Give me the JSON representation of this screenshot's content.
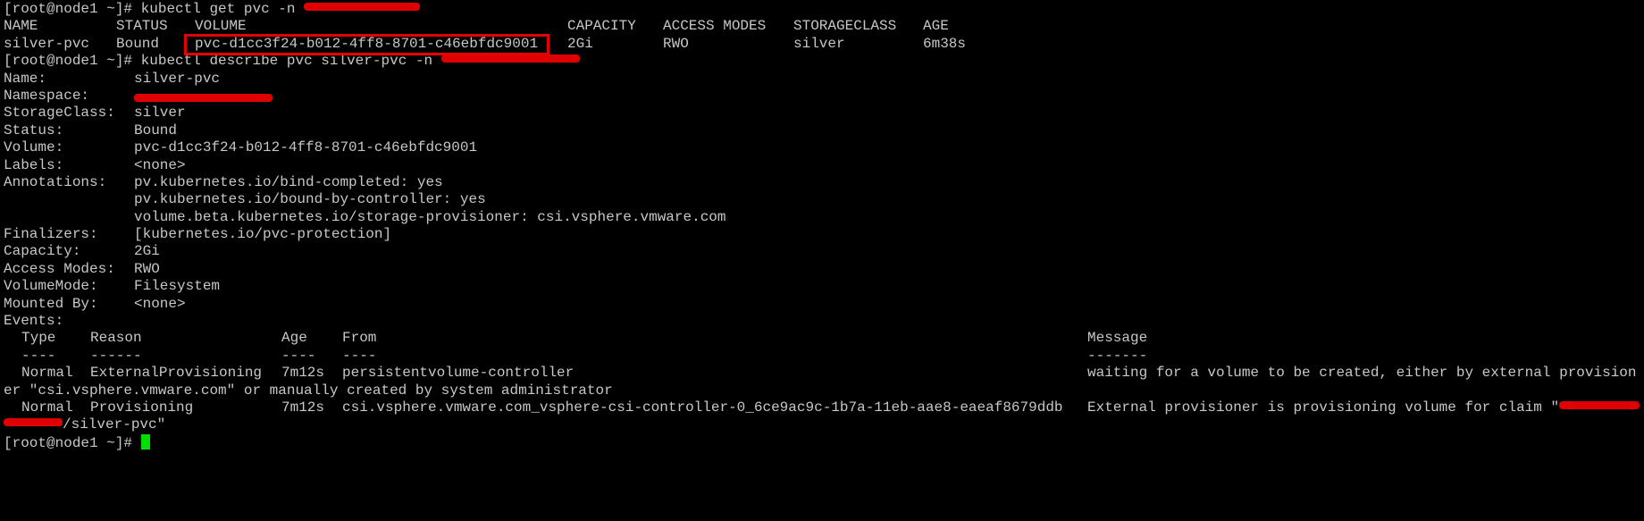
{
  "colors": {
    "background": "#000000",
    "text": "#c7c7c7",
    "highlight": "#e60000",
    "redaction": "#e00000",
    "cursor": "#00e000"
  },
  "prompt": "[root@node1 ~]#",
  "cmd1": "kubectl get pvc -n",
  "pvc_table": {
    "headers": [
      "NAME",
      "STATUS",
      "VOLUME",
      "CAPACITY",
      "ACCESS MODES",
      "STORAGECLASS",
      "AGE"
    ],
    "row": [
      "silver-pvc",
      "Bound",
      "pvc-d1cc3f24-b012-4ff8-8701-c46ebfdc9001",
      "2Gi",
      "RWO",
      "silver",
      "6m38s"
    ]
  },
  "cmd2": "kubectl describe pvc silver-pvc -n",
  "describe": {
    "name_label": "Name:",
    "name_value": "silver-pvc",
    "namespace_label": "Namespace:",
    "storageclass_label": "StorageClass:",
    "storageclass_value": "silver",
    "status_label": "Status:",
    "status_value": "Bound",
    "volume_label": "Volume:",
    "volume_value": "pvc-d1cc3f24-b012-4ff8-8701-c46ebfdc9001",
    "labels_label": "Labels:",
    "labels_value": "<none>",
    "annotations_label": "Annotations:",
    "annotations": [
      "pv.kubernetes.io/bind-completed: yes",
      "pv.kubernetes.io/bound-by-controller: yes",
      "volume.beta.kubernetes.io/storage-provisioner: csi.vsphere.vmware.com"
    ],
    "finalizers_label": "Finalizers:",
    "finalizers_value": "[kubernetes.io/pvc-protection]",
    "capacity_label": "Capacity:",
    "capacity_value": "2Gi",
    "access_modes_label": "Access Modes:",
    "access_modes_value": "RWO",
    "volume_mode_label": "VolumeMode:",
    "volume_mode_value": "Filesystem",
    "mounted_by_label": "Mounted By:",
    "mounted_by_value": "<none>",
    "events_label": "Events:"
  },
  "events": {
    "headers": [
      "Type",
      "Reason",
      "Age",
      "From",
      "Message"
    ],
    "separators": [
      "----",
      "------",
      "----",
      "----",
      "-------"
    ],
    "rows": [
      {
        "type": "Normal",
        "reason": "ExternalProvisioning",
        "age": "7m12s",
        "from": "persistentvolume-controller",
        "message": "waiting for a volume to be created, either by external provision",
        "wrap": "er \"csi.vsphere.vmware.com\" or manually created by system administrator"
      },
      {
        "type": "Normal",
        "reason": "Provisioning",
        "age": "7m12s",
        "from": "csi.vsphere.vmware.com_vsphere-csi-controller-0_6ce9ac9c-1b7a-11eb-aae8-eaeaf8679ddb",
        "message": "External provisioner is provisioning volume for claim \"",
        "wrap": "/silver-pvc\""
      }
    ]
  }
}
